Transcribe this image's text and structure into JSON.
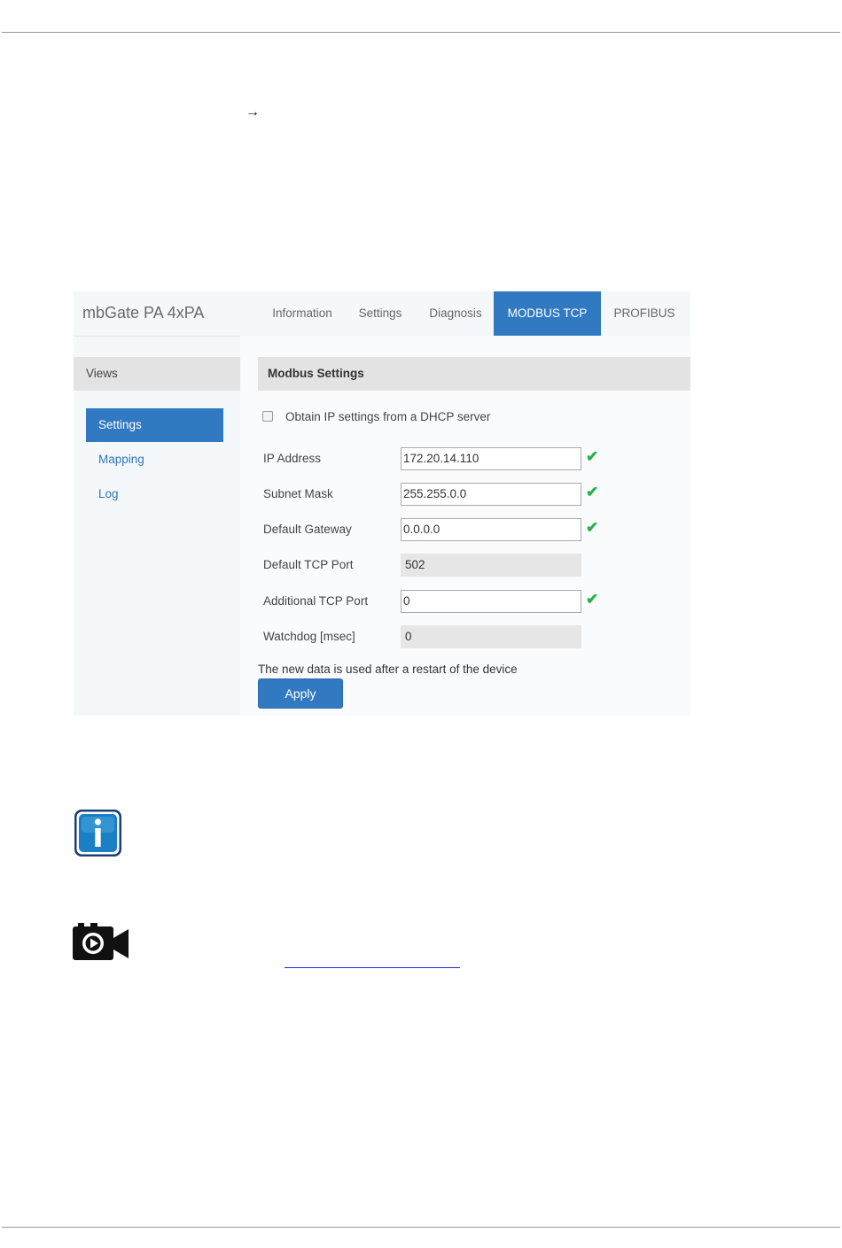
{
  "app": {
    "brand": "mbGate PA 4xPA"
  },
  "tabs": [
    {
      "label": "Information",
      "active": false
    },
    {
      "label": "Settings",
      "active": false
    },
    {
      "label": "Diagnosis",
      "active": false
    },
    {
      "label": "MODBUS TCP",
      "active": true
    },
    {
      "label": "PROFIBUS",
      "active": false
    }
  ],
  "sidebar": {
    "heading": "Views",
    "items": [
      {
        "label": "Settings",
        "active": true
      },
      {
        "label": "Mapping",
        "active": false
      },
      {
        "label": "Log",
        "active": false
      }
    ]
  },
  "panel": {
    "title": "Modbus Settings",
    "dhcp_label": "Obtain IP settings from a DHCP server",
    "dhcp_checked": false,
    "fields": [
      {
        "label": "IP Address",
        "value": "172.20.14.110",
        "editable": true,
        "valid": true
      },
      {
        "label": "Subnet Mask",
        "value": "255.255.0.0",
        "editable": true,
        "valid": true
      },
      {
        "label": "Default Gateway",
        "value": "0.0.0.0",
        "editable": true,
        "valid": true
      },
      {
        "label": "Default TCP Port",
        "value": "502",
        "editable": false,
        "valid": false
      },
      {
        "label": "Additional TCP Port",
        "value": "0",
        "editable": true,
        "valid": true
      },
      {
        "label": "Watchdog [msec]",
        "value": "0",
        "editable": false,
        "valid": false
      }
    ],
    "note": "The new data is used after a restart of the device",
    "apply_label": "Apply"
  },
  "icons": {
    "arrow": "arrow-right-icon",
    "info": "info-icon",
    "video": "video-camera-icon",
    "check": "check-icon"
  },
  "colors": {
    "accent": "#3179c0",
    "valid": "#25b24a",
    "info": "#1a7fc4"
  }
}
